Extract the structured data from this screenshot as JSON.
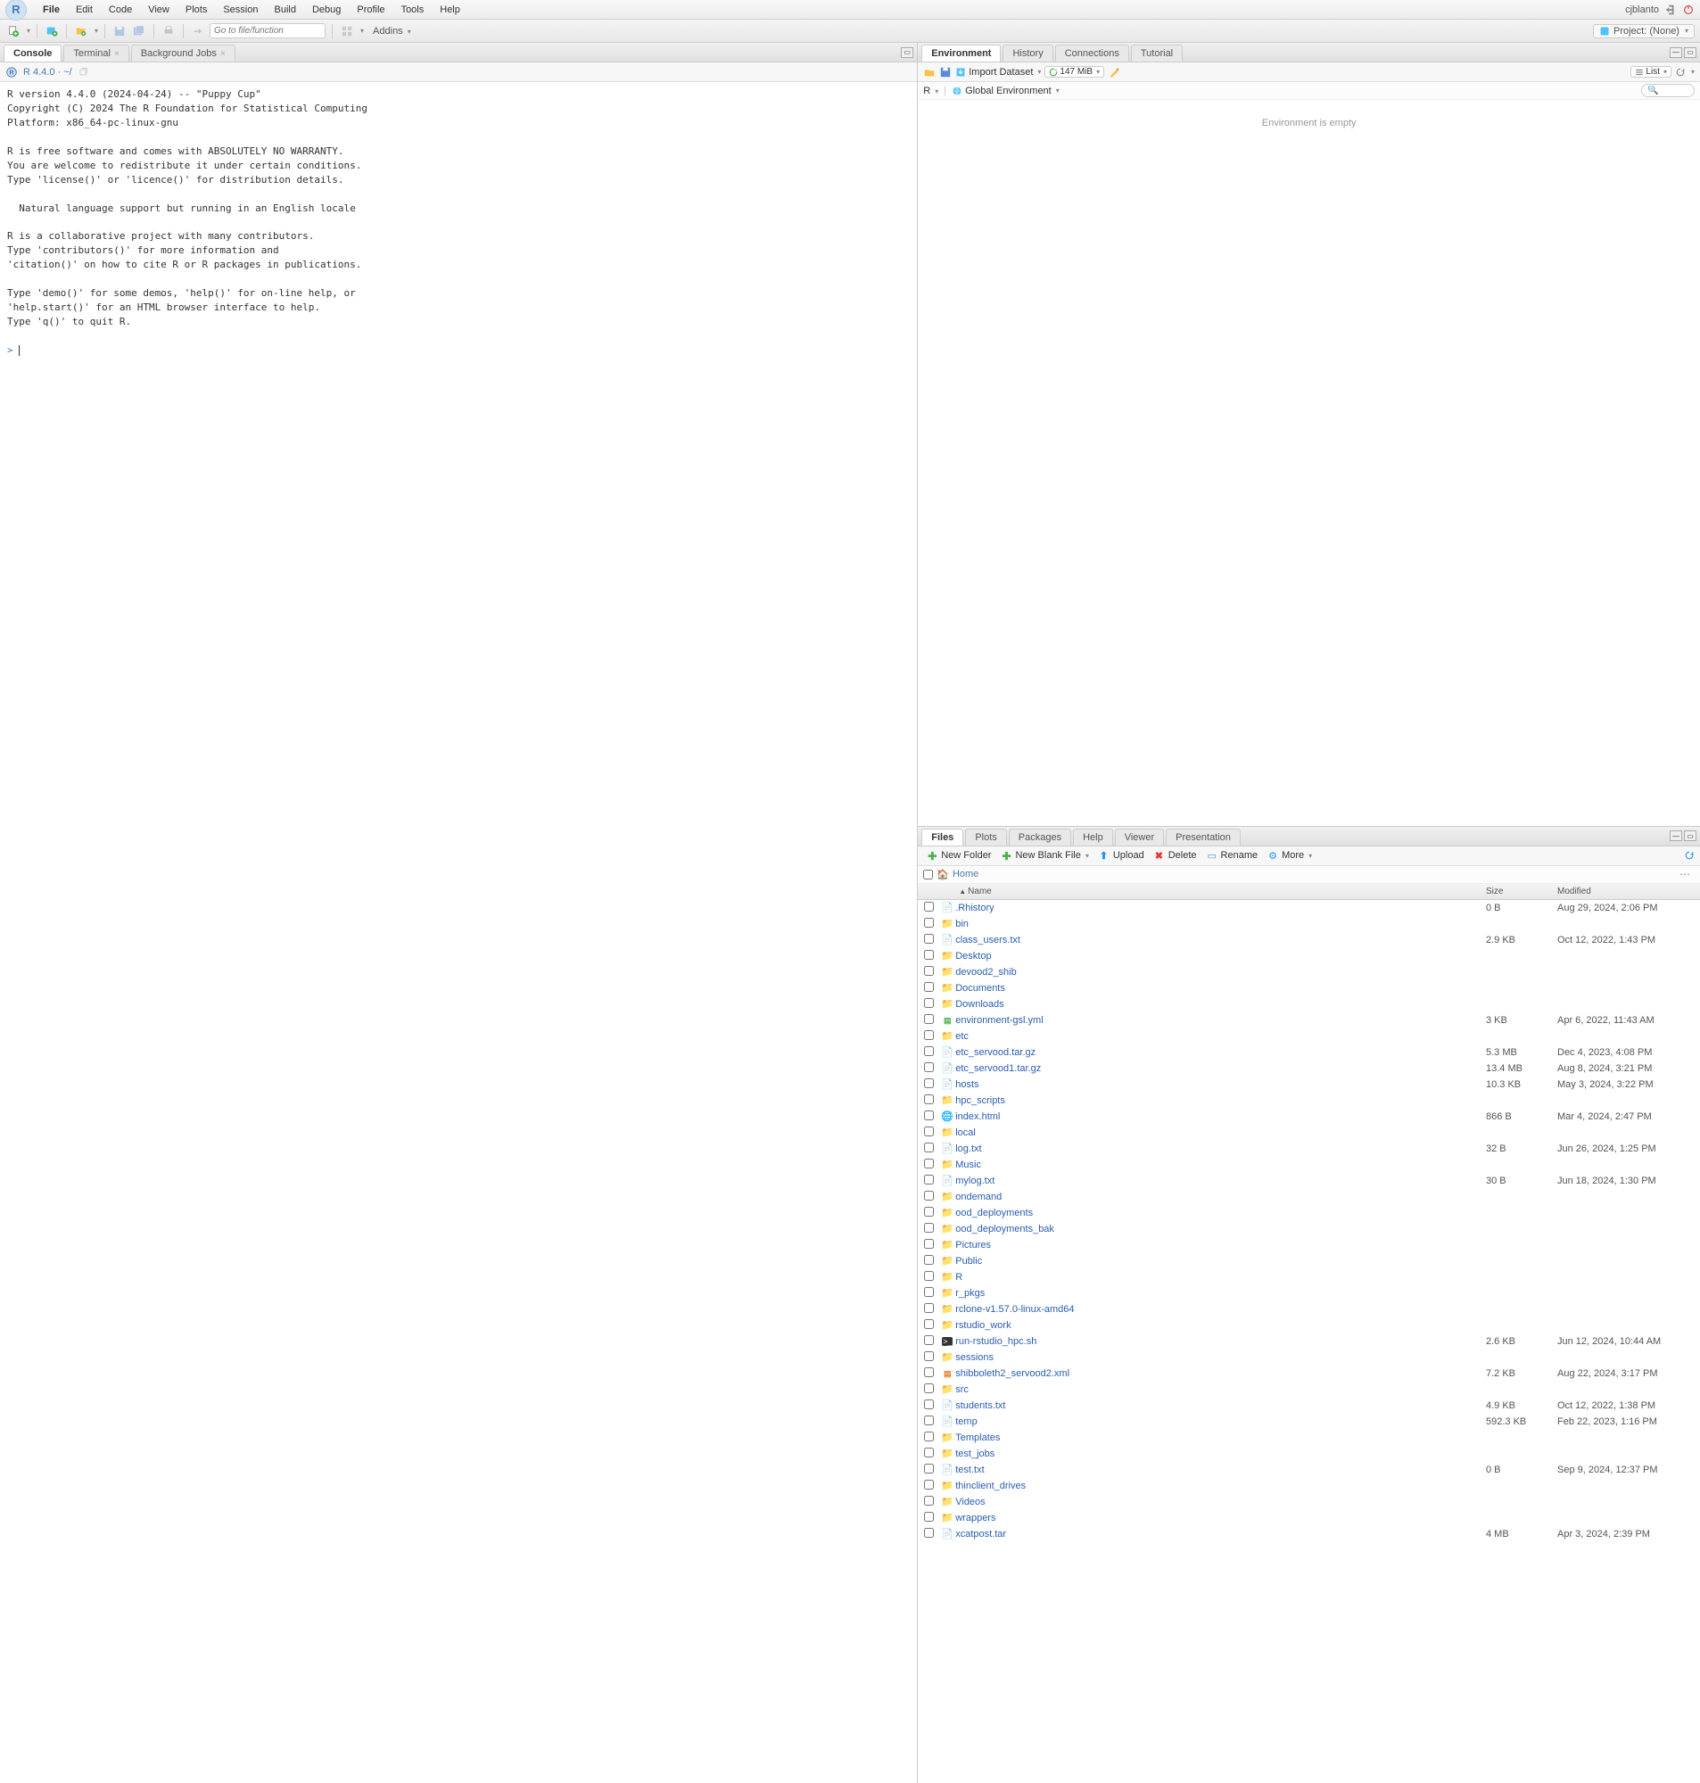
{
  "menubar": {
    "items": [
      "File",
      "Edit",
      "Code",
      "View",
      "Plots",
      "Session",
      "Build",
      "Debug",
      "Profile",
      "Tools",
      "Help"
    ],
    "user": "cjblanto"
  },
  "toolbar": {
    "goto_placeholder": "Go to file/function",
    "addins": "Addins",
    "project": "Project: (None)"
  },
  "console": {
    "tabs": [
      "Console",
      "Terminal",
      "Background Jobs"
    ],
    "version_label": "R 4.4.0 · ~/",
    "body": "R version 4.4.0 (2024-04-24) -- \"Puppy Cup\"\nCopyright (C) 2024 The R Foundation for Statistical Computing\nPlatform: x86_64-pc-linux-gnu\n\nR is free software and comes with ABSOLUTELY NO WARRANTY.\nYou are welcome to redistribute it under certain conditions.\nType 'license()' or 'licence()' for distribution details.\n\n  Natural language support but running in an English locale\n\nR is a collaborative project with many contributors.\nType 'contributors()' for more information and\n'citation()' on how to cite R or R packages in publications.\n\nType 'demo()' for some demos, 'help()' for on-line help, or\n'help.start()' for an HTML browser interface to help.\nType 'q()' to quit R.\n",
    "prompt": "> "
  },
  "env": {
    "tabs": [
      "Environment",
      "History",
      "Connections",
      "Tutorial"
    ],
    "import": "Import Dataset",
    "mem": "147 MiB",
    "list": "List",
    "lang": "R",
    "scope": "Global Environment",
    "empty": "Environment is empty"
  },
  "files": {
    "tabs": [
      "Files",
      "Plots",
      "Packages",
      "Help",
      "Viewer",
      "Presentation"
    ],
    "toolbar": {
      "newfolder": "New Folder",
      "newblank": "New Blank File",
      "upload": "Upload",
      "delete": "Delete",
      "rename": "Rename",
      "more": "More"
    },
    "breadcrumb": "Home",
    "headers": {
      "name": "Name",
      "size": "Size",
      "modified": "Modified"
    },
    "rows": [
      {
        "icon": "file",
        "name": ".Rhistory",
        "size": "0 B",
        "mod": "Aug 29, 2024, 2:06 PM"
      },
      {
        "icon": "folder",
        "name": "bin",
        "size": "",
        "mod": ""
      },
      {
        "icon": "file",
        "name": "class_users.txt",
        "size": "2.9 KB",
        "mod": "Oct 12, 2022, 1:43 PM"
      },
      {
        "icon": "folder",
        "name": "Desktop",
        "size": "",
        "mod": ""
      },
      {
        "icon": "folder",
        "name": "devood2_shib",
        "size": "",
        "mod": ""
      },
      {
        "icon": "folder",
        "name": "Documents",
        "size": "",
        "mod": ""
      },
      {
        "icon": "folder",
        "name": "Downloads",
        "size": "",
        "mod": ""
      },
      {
        "icon": "yml",
        "name": "environment-gsl.yml",
        "size": "3 KB",
        "mod": "Apr 6, 2022, 11:43 AM"
      },
      {
        "icon": "folder",
        "name": "etc",
        "size": "",
        "mod": ""
      },
      {
        "icon": "file",
        "name": "etc_servood.tar.gz",
        "size": "5.3 MB",
        "mod": "Dec 4, 2023, 4:08 PM"
      },
      {
        "icon": "file",
        "name": "etc_servood1.tar.gz",
        "size": "13.4 MB",
        "mod": "Aug 8, 2024, 3:21 PM"
      },
      {
        "icon": "file",
        "name": "hosts",
        "size": "10.3 KB",
        "mod": "May 3, 2024, 3:22 PM"
      },
      {
        "icon": "folder",
        "name": "hpc_scripts",
        "size": "",
        "mod": ""
      },
      {
        "icon": "html",
        "name": "index.html",
        "size": "866 B",
        "mod": "Mar 4, 2024, 2:47 PM"
      },
      {
        "icon": "folder",
        "name": "local",
        "size": "",
        "mod": ""
      },
      {
        "icon": "file",
        "name": "log.txt",
        "size": "32 B",
        "mod": "Jun 26, 2024, 1:25 PM"
      },
      {
        "icon": "folder",
        "name": "Music",
        "size": "",
        "mod": ""
      },
      {
        "icon": "file",
        "name": "mylog.txt",
        "size": "30 B",
        "mod": "Jun 18, 2024, 1:30 PM"
      },
      {
        "icon": "folder",
        "name": "ondemand",
        "size": "",
        "mod": ""
      },
      {
        "icon": "folder",
        "name": "ood_deployments",
        "size": "",
        "mod": ""
      },
      {
        "icon": "folder",
        "name": "ood_deployments_bak",
        "size": "",
        "mod": ""
      },
      {
        "icon": "folder",
        "name": "Pictures",
        "size": "",
        "mod": ""
      },
      {
        "icon": "folder",
        "name": "Public",
        "size": "",
        "mod": ""
      },
      {
        "icon": "folder",
        "name": "R",
        "size": "",
        "mod": ""
      },
      {
        "icon": "folder",
        "name": "r_pkgs",
        "size": "",
        "mod": ""
      },
      {
        "icon": "folder",
        "name": "rclone-v1.57.0-linux-amd64",
        "size": "",
        "mod": ""
      },
      {
        "icon": "folder",
        "name": "rstudio_work",
        "size": "",
        "mod": ""
      },
      {
        "icon": "sh",
        "name": "run-rstudio_hpc.sh",
        "size": "2.6 KB",
        "mod": "Jun 12, 2024, 10:44 AM"
      },
      {
        "icon": "folder",
        "name": "sessions",
        "size": "",
        "mod": ""
      },
      {
        "icon": "xml",
        "name": "shibboleth2_servood2.xml",
        "size": "7.2 KB",
        "mod": "Aug 22, 2024, 3:17 PM"
      },
      {
        "icon": "folder",
        "name": "src",
        "size": "",
        "mod": ""
      },
      {
        "icon": "file",
        "name": "students.txt",
        "size": "4.9 KB",
        "mod": "Oct 12, 2022, 1:38 PM"
      },
      {
        "icon": "file",
        "name": "temp",
        "size": "592.3 KB",
        "mod": "Feb 22, 2023, 1:16 PM"
      },
      {
        "icon": "folder",
        "name": "Templates",
        "size": "",
        "mod": ""
      },
      {
        "icon": "folder",
        "name": "test_jobs",
        "size": "",
        "mod": ""
      },
      {
        "icon": "file",
        "name": "test.txt",
        "size": "0 B",
        "mod": "Sep 9, 2024, 12:37 PM"
      },
      {
        "icon": "folder",
        "name": "thinclient_drives",
        "size": "",
        "mod": ""
      },
      {
        "icon": "folder",
        "name": "Videos",
        "size": "",
        "mod": ""
      },
      {
        "icon": "folder",
        "name": "wrappers",
        "size": "",
        "mod": ""
      },
      {
        "icon": "file",
        "name": "xcatpost.tar",
        "size": "4 MB",
        "mod": "Apr 3, 2024, 2:39 PM"
      }
    ]
  }
}
